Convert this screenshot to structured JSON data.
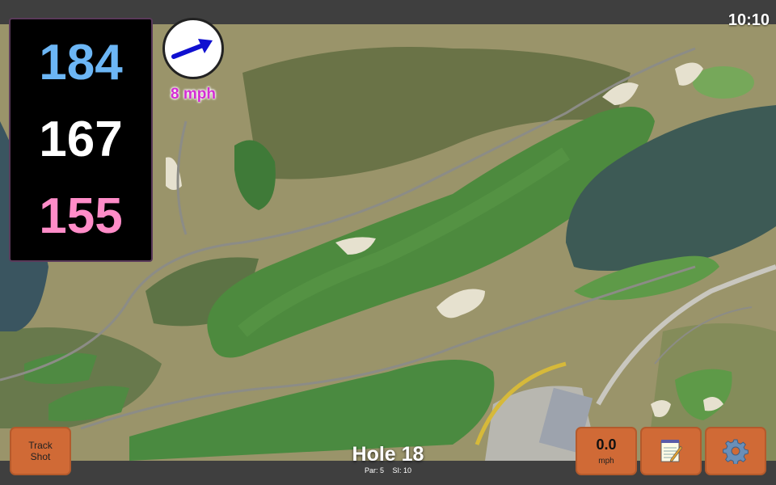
{
  "clock": "10:10",
  "distances": {
    "back": "184",
    "middle": "167",
    "front": "155"
  },
  "wind": {
    "label": "8 mph",
    "icon": "wind-direction-arrow-icon"
  },
  "buttons": {
    "track_shot": {
      "line1": "Track",
      "line2": "Shot"
    },
    "speed": {
      "value": "0.0",
      "unit": "mph"
    },
    "notes": {
      "icon": "notepad-icon"
    },
    "settings": {
      "icon": "gear-icon"
    }
  },
  "hole": {
    "title": "Hole 18",
    "par": "Par: 5",
    "si": "SI: 10"
  },
  "colors": {
    "back": "#6cb6f5",
    "middle": "#ffffff",
    "front": "#ff8cc8",
    "wind_label": "#d42dd4",
    "button": "#d06a36"
  }
}
